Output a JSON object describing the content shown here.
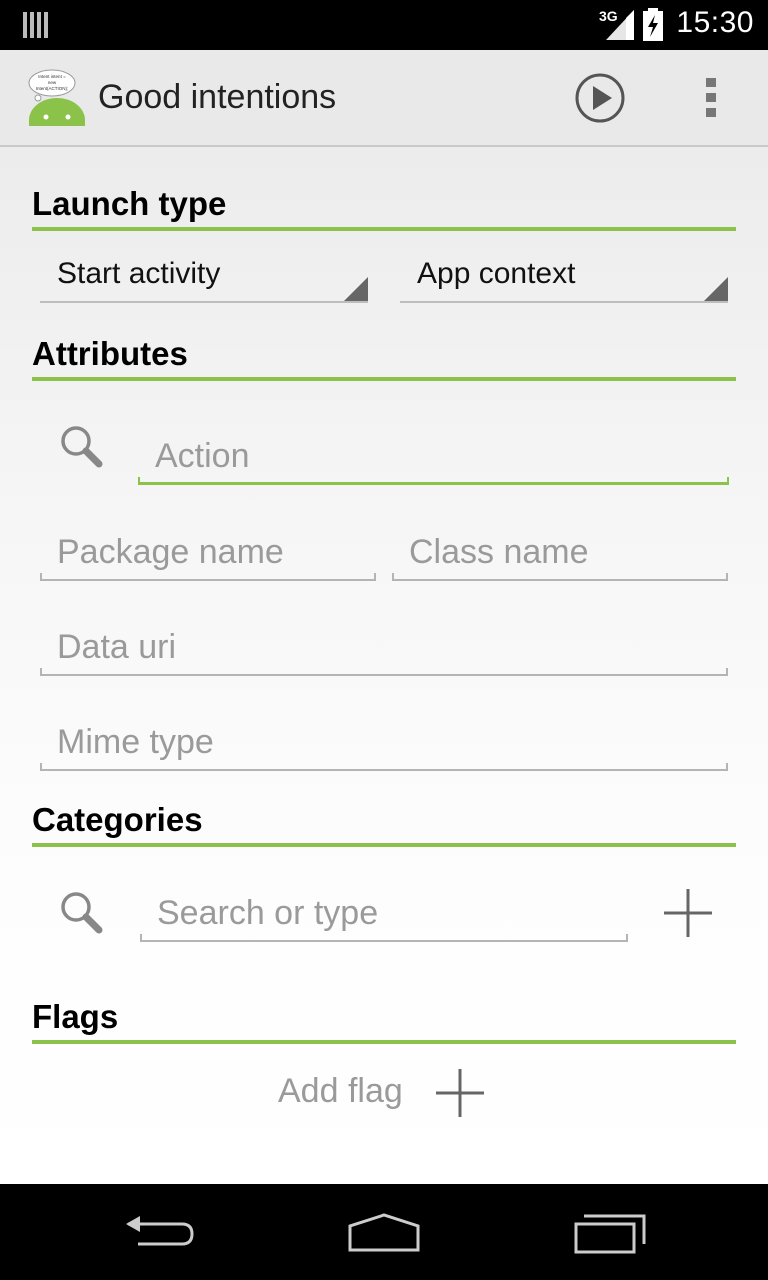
{
  "status_bar": {
    "time": "15:30",
    "network": "3G"
  },
  "action_bar": {
    "title": "Good intentions",
    "logo_text": "Intent intent = new Intent(ACTION);",
    "play_icon": "play-circle-icon",
    "overflow_icon": "overflow-menu-icon"
  },
  "launch_type": {
    "title": "Launch type",
    "launch_method": "Start activity",
    "context": "App context"
  },
  "attributes": {
    "title": "Attributes",
    "action_placeholder": "Action",
    "package_placeholder": "Package name",
    "class_placeholder": "Class name",
    "data_uri_placeholder": "Data uri",
    "mime_type_placeholder": "Mime type"
  },
  "categories": {
    "title": "Categories",
    "search_placeholder": "Search or type"
  },
  "flags": {
    "title": "Flags",
    "add_label": "Add flag"
  },
  "colors": {
    "accent": "#8bc34a",
    "status_bar": "#000000",
    "action_bar": "#e9e9e9"
  }
}
